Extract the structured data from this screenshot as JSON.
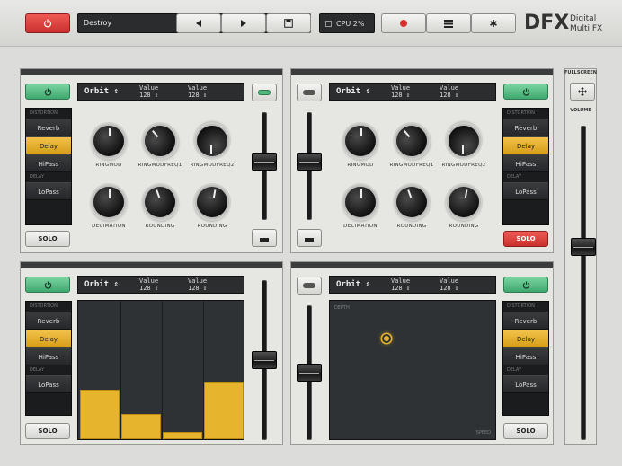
{
  "topbar": {
    "preset_name": "Destroy",
    "cpu_label": "CPU 2%"
  },
  "brand": {
    "logo": "DFX",
    "line1": "Digital",
    "line2": "Multi FX"
  },
  "right": {
    "fullscreen_label": "FULLSCREEN",
    "volume_label": "VOLUME",
    "volume_level": 0.62
  },
  "effects": [
    "Reverb",
    "Delay",
    "HiPass",
    "LoPass"
  ],
  "categories": [
    "DISTORTION",
    "DELAY"
  ],
  "panels": [
    {
      "preset": "Orbit",
      "value_label_1": "Value",
      "value_num_1": "128",
      "value_label_2": "Value",
      "value_num_2": "128",
      "knobs": [
        "RINGMOD",
        "RINGMODFREQ1",
        "RINGMODFREQ2",
        "DECIMATION",
        "ROUNDING",
        "ROUNDING"
      ],
      "selected_effect": "Delay",
      "solo_label": "SOLO",
      "solo_active": false,
      "fader_level": 0.55
    },
    {
      "preset": "Orbit",
      "value_label_1": "Value",
      "value_num_1": "128",
      "value_label_2": "Value",
      "value_num_2": "128",
      "knobs": [
        "RINGMOD",
        "RINGMODFREQ1",
        "RINGMODFREQ2",
        "DECIMATION",
        "ROUNDING",
        "ROUNDING"
      ],
      "selected_effect": "Delay",
      "solo_label": "SOLO",
      "solo_active": true,
      "fader_level": 0.55
    },
    {
      "preset": "Orbit",
      "value_label_1": "Value",
      "value_num_1": "128",
      "value_label_2": "Value",
      "value_num_2": "128",
      "selected_effect": "Delay",
      "solo_label": "SOLO",
      "solo_active": false,
      "fader_level": 0.5,
      "step_values": [
        0.36,
        0.18,
        0.05,
        0.41
      ]
    },
    {
      "preset": "Orbit",
      "value_label_1": "Value",
      "value_num_1": "128",
      "value_label_2": "Value",
      "value_num_2": "128",
      "selected_effect": "Delay",
      "solo_label": "SOLO",
      "solo_active": false,
      "fader_level": 0.5,
      "xy_label_top": "DEPTH",
      "xy_label_bottom": "SPEED",
      "xy_point": [
        0.34,
        0.73
      ]
    }
  ],
  "colors": {
    "accent_green": "#4fb97e",
    "accent_red": "#e0413c",
    "accent_yellow": "#e7b52d"
  }
}
